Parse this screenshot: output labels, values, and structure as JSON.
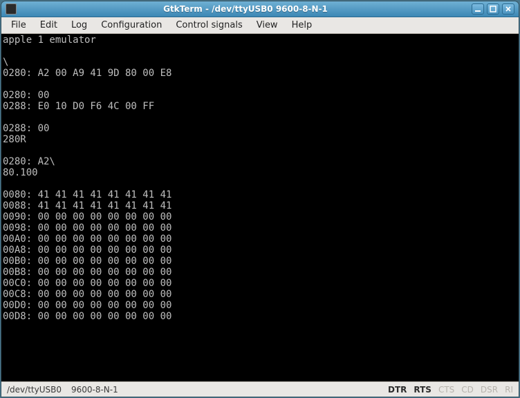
{
  "window": {
    "title": "GtkTerm - /dev/ttyUSB0  9600-8-N-1"
  },
  "menubar": [
    "File",
    "Edit",
    "Log",
    "Configuration",
    "Control signals",
    "View",
    "Help"
  ],
  "terminal": {
    "lines": [
      "apple 1 emulator",
      "",
      "\\",
      "0280: A2 00 A9 41 9D 80 00 E8",
      "",
      "0280: 00",
      "0288: E0 10 D0 F6 4C 00 FF",
      "",
      "0288: 00",
      "280R",
      "",
      "0280: A2\\",
      "80.100",
      "",
      "0080: 41 41 41 41 41 41 41 41",
      "0088: 41 41 41 41 41 41 41 41",
      "0090: 00 00 00 00 00 00 00 00",
      "0098: 00 00 00 00 00 00 00 00",
      "00A0: 00 00 00 00 00 00 00 00",
      "00A8: 00 00 00 00 00 00 00 00",
      "00B0: 00 00 00 00 00 00 00 00",
      "00B8: 00 00 00 00 00 00 00 00",
      "00C0: 00 00 00 00 00 00 00 00",
      "00C8: 00 00 00 00 00 00 00 00",
      "00D0: 00 00 00 00 00 00 00 00",
      "00D8: 00 00 00 00 00 00 00 00"
    ]
  },
  "statusbar": {
    "device": "/dev/ttyUSB0",
    "params": "9600-8-N-1",
    "signals": [
      {
        "name": "DTR",
        "active": true
      },
      {
        "name": "RTS",
        "active": true
      },
      {
        "name": "CTS",
        "active": false
      },
      {
        "name": "CD",
        "active": false
      },
      {
        "name": "DSR",
        "active": false
      },
      {
        "name": "RI",
        "active": false
      }
    ]
  }
}
